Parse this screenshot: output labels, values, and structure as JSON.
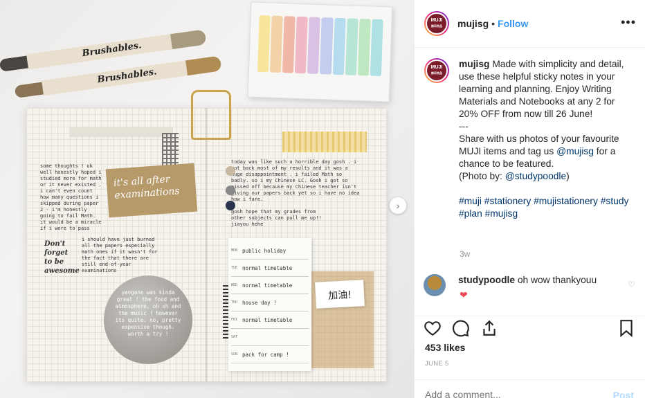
{
  "post_image": {
    "pen_brand": "Brushables.",
    "sticker_text": "it's all after examinations",
    "note_days": [
      "MON",
      "TUE",
      "WED",
      "THU",
      "FRI",
      "SAT",
      "SUN"
    ],
    "note_entries": [
      "public holiday",
      "normal timetable",
      "normal timetable",
      "house day !",
      "normal timetable",
      "",
      "pack for camp !"
    ],
    "tag_text": "加油!",
    "moon_text": "yeogane was kinda great ! the food and atmosphere, oh oh and the music ! however its quite, no, pretty expensive though. worth a try !",
    "left_notes": "some thoughts ! ok well honestly hoped i studied more for math or it never existed . i can't even count how many questions i skipped during paper 2 - i'm honestly going to fail Math. it would be a miracle if i were to pass",
    "left_notes_2": "i should have just burned all the papers especially math ones if it wasn't for the fact that there are still end-of-year examinations",
    "right_notes": "today was like such a horrible day gosh . i got back most of my results and it was a huge disappointment . i failed Math so badly. so i my Chinese LC. Gosh i got so pissed off because my Chinese teacher isn't giving our papers back yet so i have no idea how i fare.",
    "right_notes_2": "gosh hope that my grades from other subjects can pull me up!! jiayou hehe",
    "dont_forget": "Don't forget to be awesome"
  },
  "header": {
    "username": "mujisg",
    "separator": "•",
    "follow_label": "Follow",
    "more_label": "•••",
    "avatar_text_top": "MUJI",
    "avatar_text_bottom": "無印良品"
  },
  "caption": {
    "username": "mujisg",
    "text_1": "Made with simplicity and detail, use these helpful sticky notes in your learning and planning. Enjoy Writing Materials and Notebooks at any 2 for 20% OFF from now till 26 June!",
    "dashes": "---",
    "text_2a": "Share with us photos of your favourite MUJI items and tag us ",
    "mention": "@mujisg",
    "text_2b": " for a chance to be featured.",
    "photo_by_prefix": "(Photo by: ",
    "photo_by_user": "@studypoodle",
    "photo_by_suffix": ")",
    "hashtags": "#muji #stationery #mujistationery #study #plan #mujisg",
    "age": "3w"
  },
  "comment": {
    "username": "studypoodle",
    "text": "oh wow thankyouu"
  },
  "actions": {
    "likes": "453 likes",
    "date": "JUNE 5",
    "comment_placeholder": "Add a comment...",
    "post_label": "Post"
  },
  "colors": {
    "link": "#003569",
    "follow": "#3897f0",
    "muted": "#999999",
    "heart": "#ed4956",
    "muji_red": "#7a1c2a"
  },
  "icons": [
    "more-icon",
    "heart-icon",
    "comment-icon",
    "share-icon",
    "bookmark-icon",
    "next-arrow-icon"
  ]
}
